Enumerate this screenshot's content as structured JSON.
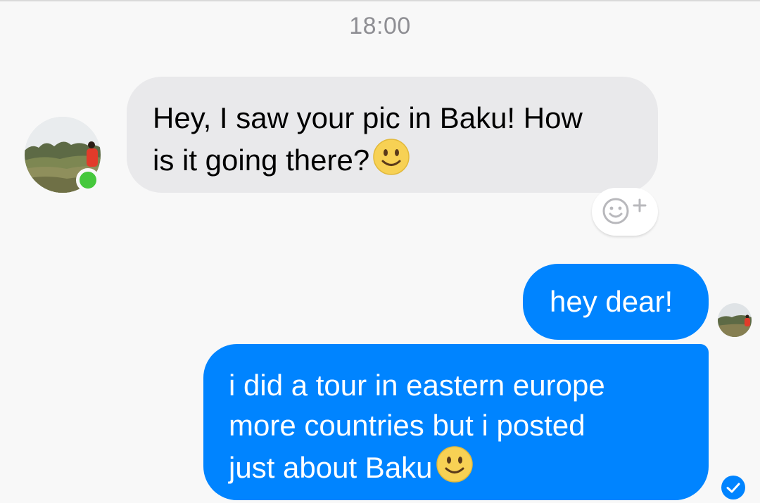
{
  "timestamp": "18:00",
  "messages": [
    {
      "direction": "incoming",
      "lines": [
        "Hey, I saw your pic in Baku! How",
        "is it going there?"
      ],
      "emoji": "slightly-smiling-face"
    },
    {
      "direction": "outgoing",
      "lines": [
        "hey dear!"
      ]
    },
    {
      "direction": "outgoing",
      "lines": [
        "i did a tour in eastern europe",
        "more countries but i posted",
        "just about Baku"
      ],
      "emoji": "slightly-smiling-face"
    }
  ],
  "contact": {
    "online": true
  },
  "reaction_button": {
    "icon": "add-reaction-icon"
  },
  "read_receipt": {
    "icon": "check-circle-icon"
  },
  "colors": {
    "outgoing_bubble": "#0084ff",
    "incoming_bubble": "#e9e9eb",
    "online": "#45c83c",
    "timestamp": "#8e8e93"
  }
}
